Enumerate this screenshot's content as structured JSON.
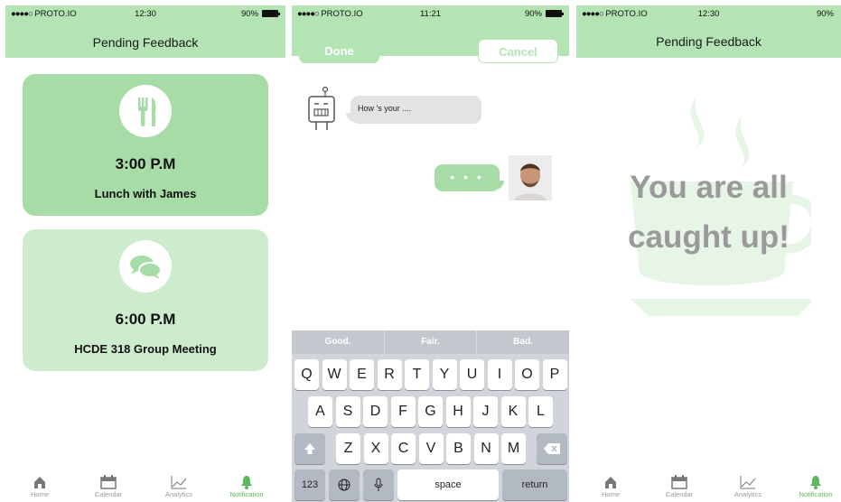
{
  "status": {
    "carrier": "PROTO.IO",
    "battery": "90%",
    "time_1": "12:30",
    "time_2": "11:21",
    "time_3": "12:30"
  },
  "screen1": {
    "title": "Pending Feedback",
    "cards": [
      {
        "time": "3:00 P.M",
        "event": "Lunch with James",
        "icon": "fork-knife-icon"
      },
      {
        "time": "6:00 P.M",
        "event": "HCDE 318 Group Meeting",
        "icon": "chat-bubbles-icon"
      }
    ]
  },
  "screen2": {
    "done": "Done",
    "cancel": "Cancel",
    "incoming_message": "How 's your ....",
    "typing": "• • •",
    "suggestions": [
      "Good.",
      "Fair.",
      "Bad."
    ],
    "keys_row1": [
      "Q",
      "W",
      "E",
      "R",
      "T",
      "Y",
      "U",
      "I",
      "O",
      "P"
    ],
    "keys_row2": [
      "A",
      "S",
      "D",
      "F",
      "G",
      "H",
      "J",
      "K",
      "L"
    ],
    "keys_row3": [
      "Z",
      "X",
      "C",
      "V",
      "B",
      "N",
      "M"
    ],
    "key_123": "123",
    "key_space": "space",
    "key_return": "return"
  },
  "screen3": {
    "title": "Pending Feedback",
    "line1": "You are all",
    "line2": "caught up!"
  },
  "tabs": [
    {
      "label": "Home",
      "icon": "home-icon"
    },
    {
      "label": "Calendar",
      "icon": "calendar-icon"
    },
    {
      "label": "Analytics",
      "icon": "analytics-icon"
    },
    {
      "label": "Notification",
      "icon": "bell-icon",
      "active": true
    }
  ],
  "colors": {
    "header": "#b4e4b4",
    "card_primary": "#a7dca7",
    "card_secondary": "#cdeccd",
    "active_tab": "#5cb85c"
  }
}
